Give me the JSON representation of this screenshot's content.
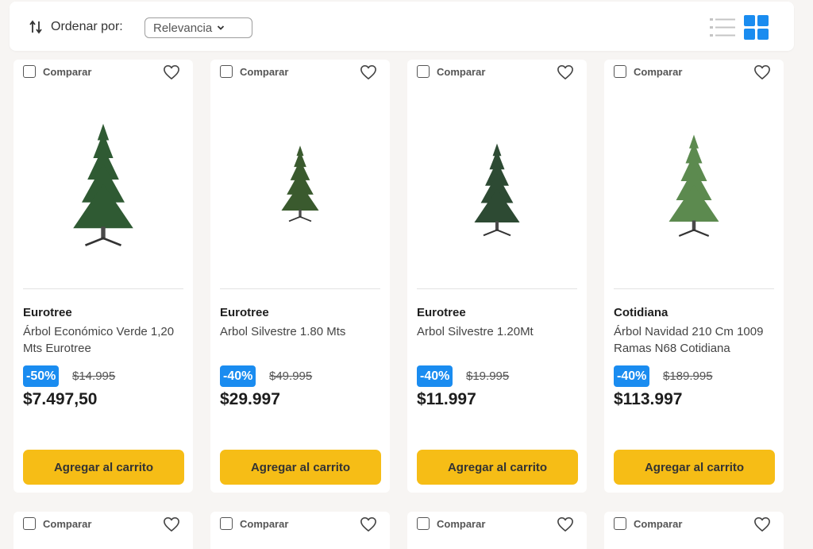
{
  "toolbar": {
    "sort_label": "Ordenar por:",
    "sort_value": "Relevancia",
    "sort_icon": "sort-arrows-icon",
    "list_view_icon": "list-view-icon",
    "grid_view_icon": "grid-view-icon",
    "accent": "#1a8cf0"
  },
  "products": [
    {
      "compare_label": "Comparar",
      "brand": "Eurotree",
      "name": "Árbol Económico Verde 1,20 Mts Eurotree",
      "discount": "-50%",
      "old_price": "$14.995",
      "price": "$7.497,50",
      "cart_label": "Agregar al carrito",
      "image": "christmas-tree"
    },
    {
      "compare_label": "Comparar",
      "brand": "Eurotree",
      "name": "Arbol Silvestre 1.80 Mts",
      "discount": "-40%",
      "old_price": "$49.995",
      "price": "$29.997",
      "cart_label": "Agregar al carrito",
      "image": "christmas-tree"
    },
    {
      "compare_label": "Comparar",
      "brand": "Eurotree",
      "name": "Arbol Silvestre 1.20Mt",
      "discount": "-40%",
      "old_price": "$19.995",
      "price": "$11.997",
      "cart_label": "Agregar al carrito",
      "image": "christmas-tree"
    },
    {
      "compare_label": "Comparar",
      "brand": "Cotidiana",
      "name": "Árbol Navidad 210 Cm 1009 Ramas N68 Cotidiana",
      "discount": "-40%",
      "old_price": "$189.995",
      "price": "$113.997",
      "cart_label": "Agregar al carrito",
      "image": "christmas-tree"
    }
  ],
  "next_row": [
    {
      "compare_label": "Comparar"
    },
    {
      "compare_label": "Comparar"
    },
    {
      "compare_label": "Comparar"
    },
    {
      "compare_label": "Comparar"
    }
  ],
  "colors": {
    "cart_button": "#f6bd16",
    "discount_badge": "#1a8cf0"
  }
}
